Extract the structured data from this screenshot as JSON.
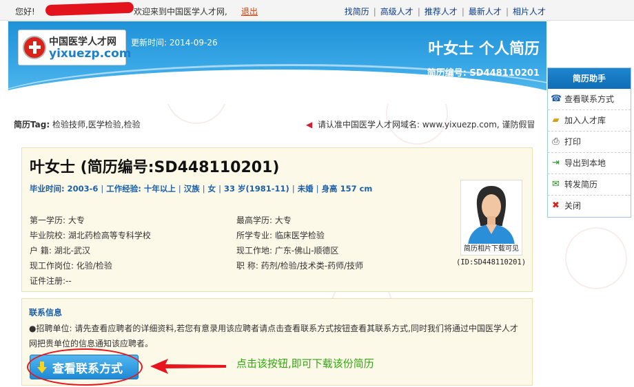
{
  "topbar": {
    "greeting": "您好!",
    "welcome": "欢迎来到中国医学人才网,",
    "logout": "退出",
    "nav": [
      "找简历",
      "高级人才",
      "推荐人才",
      "最新人才",
      "相片人才"
    ]
  },
  "header": {
    "logo_cn": "中国医学人才网",
    "logo_en": "yixuezp.com",
    "update": "更新时间: 2014-09-26",
    "title": "叶女士  个人简历",
    "resume_no": "简历编号: SD448110201"
  },
  "sidebar": {
    "title": "简历助手",
    "items": [
      {
        "label": "查看联系方式",
        "icon": "phone-icon",
        "glyph": "☎",
        "color": "#1f5fa8"
      },
      {
        "label": "加入人才库",
        "icon": "folder-icon",
        "glyph": "▰",
        "color": "#d4a017"
      },
      {
        "label": "打印",
        "icon": "printer-icon",
        "glyph": "⎙",
        "color": "#444444"
      },
      {
        "label": "导出到本地",
        "icon": "export-icon",
        "glyph": "⇥",
        "color": "#2a8a2a"
      },
      {
        "label": "转发简历",
        "icon": "forward-icon",
        "glyph": "✉",
        "color": "#2a8a2a"
      },
      {
        "label": "关闭",
        "icon": "close-icon",
        "glyph": "✖",
        "color": "#d8231b"
      }
    ]
  },
  "tags": {
    "label": "简历Tag:",
    "value": "检验技师,医学检验,检验"
  },
  "notice": "请认准中国医学人才网域名: www.yixuezp.com, 谨防假冒",
  "resume": {
    "name": "叶女士 (简历编号:SD448110201)",
    "brief": [
      "毕业时间: 2003-6",
      "工作经验: 十年以上",
      "汉族",
      "女",
      "33 岁(1981-11)",
      "未婚",
      "身高 157 cm"
    ],
    "fields": {
      "edu_first": "第一学历: 大专",
      "edu_highest": "最高学历: 大专",
      "school": "毕业院校: 湖北药检高等专科学校",
      "major": "所学专业: 临床医学检验",
      "hukou": "户  籍: 湖北-武汉",
      "workplace": "现工作地: 广东-佛山-顺德区",
      "position": "现工作岗位: 化验/检验",
      "title": "职  称: 药剂/检验/技术类-药师/技师",
      "cert": "证件注册:--"
    },
    "photo_caption": "简历相片下载可见",
    "photo_id": "(ID:SD448110201)"
  },
  "contact": {
    "title": "联系信息",
    "text": "●招聘单位: 请先查看应聘者的详细资料,若您有意录用该应聘者请点击查看联系方式按钮查看其联系方式,同时我们将通过中国医学人才网把贵单位的信息通知该应聘者。",
    "button": "查看联系方式",
    "hint": "点击该按钮,即可下载该份简历"
  },
  "colors": {
    "header_blue": "#2a9ee0",
    "link_blue": "#1a5fa8",
    "accent_red": "#e8161c",
    "hint_green": "#2fa70c"
  }
}
